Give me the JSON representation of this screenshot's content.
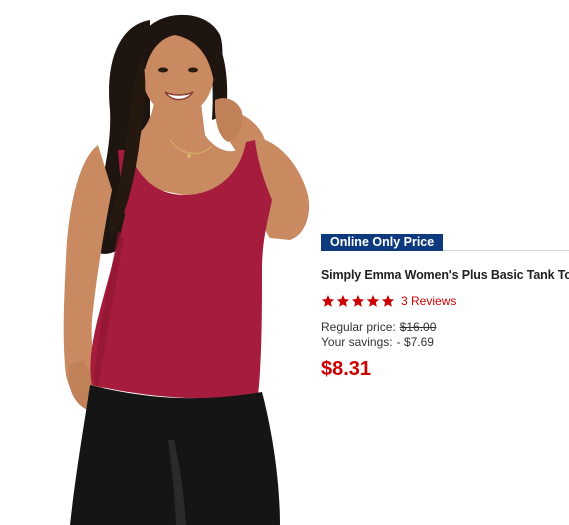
{
  "product": {
    "badge": "Online Only Price",
    "title": "Simply Emma Women's Plus Basic Tank Top",
    "rating": {
      "stars": 5,
      "reviews_label": "3 Reviews"
    },
    "regular_price_label": "Regular price:",
    "regular_price": "$16.00",
    "savings_label": "Your savings:",
    "savings_value": "- $7.69",
    "sale_price": "$8.31"
  },
  "colors": {
    "badge_bg": "#0d3a7c",
    "accent_red": "#cc0000",
    "tank_top": "#a51c3c",
    "leggings": "#151515"
  },
  "icons": [
    "star-icon"
  ]
}
